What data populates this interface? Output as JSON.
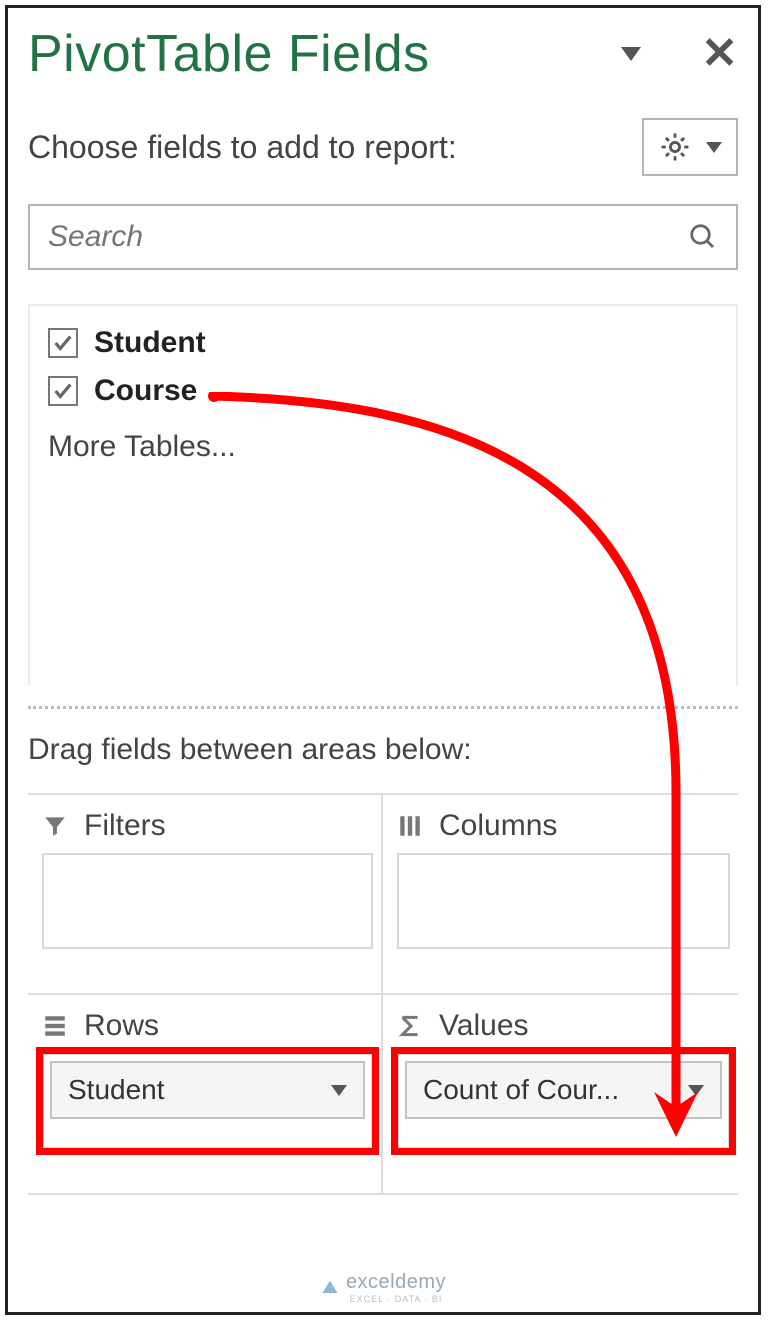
{
  "header": {
    "title": "PivotTable Fields"
  },
  "subheader": {
    "text": "Choose fields to add to report:"
  },
  "search": {
    "placeholder": "Search"
  },
  "fields": {
    "items": [
      {
        "label": "Student",
        "checked": true
      },
      {
        "label": "Course",
        "checked": true
      }
    ],
    "more_label": "More Tables..."
  },
  "drag_label": "Drag fields between areas below:",
  "areas": {
    "filters": {
      "title": "Filters"
    },
    "columns": {
      "title": "Columns"
    },
    "rows": {
      "title": "Rows",
      "pill": "Student"
    },
    "values": {
      "title": "Values",
      "pill": "Count of Cour..."
    }
  },
  "watermark": {
    "brand": "exceldemy",
    "sub": "EXCEL · DATA · BI"
  }
}
